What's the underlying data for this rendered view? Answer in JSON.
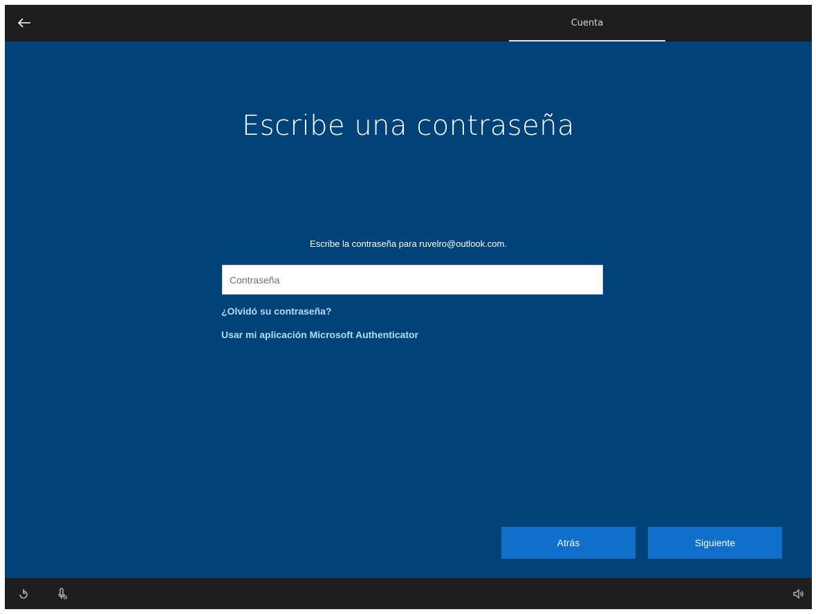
{
  "header": {
    "back_icon": "back-arrow-icon",
    "tab_label": "Cuenta"
  },
  "main": {
    "title": "Escribe una contraseña",
    "prompt": "Escribe la contraseña para ruvelro@outlook.com.",
    "password_placeholder": "Contraseña",
    "password_value": "",
    "forgot_link": "¿Olvidó su contraseña?",
    "authenticator_link": "Usar mi aplicación Microsoft Authenticator"
  },
  "buttons": {
    "back_label": "Atrás",
    "next_label": "Siguiente"
  },
  "footer": {
    "icons": [
      "ease-of-access-icon",
      "microphone-icon",
      "volume-icon"
    ]
  },
  "colors": {
    "background": "#014378",
    "bar": "#1e1e1e",
    "button": "#0f6fcb",
    "link": "#b5dcf5"
  }
}
